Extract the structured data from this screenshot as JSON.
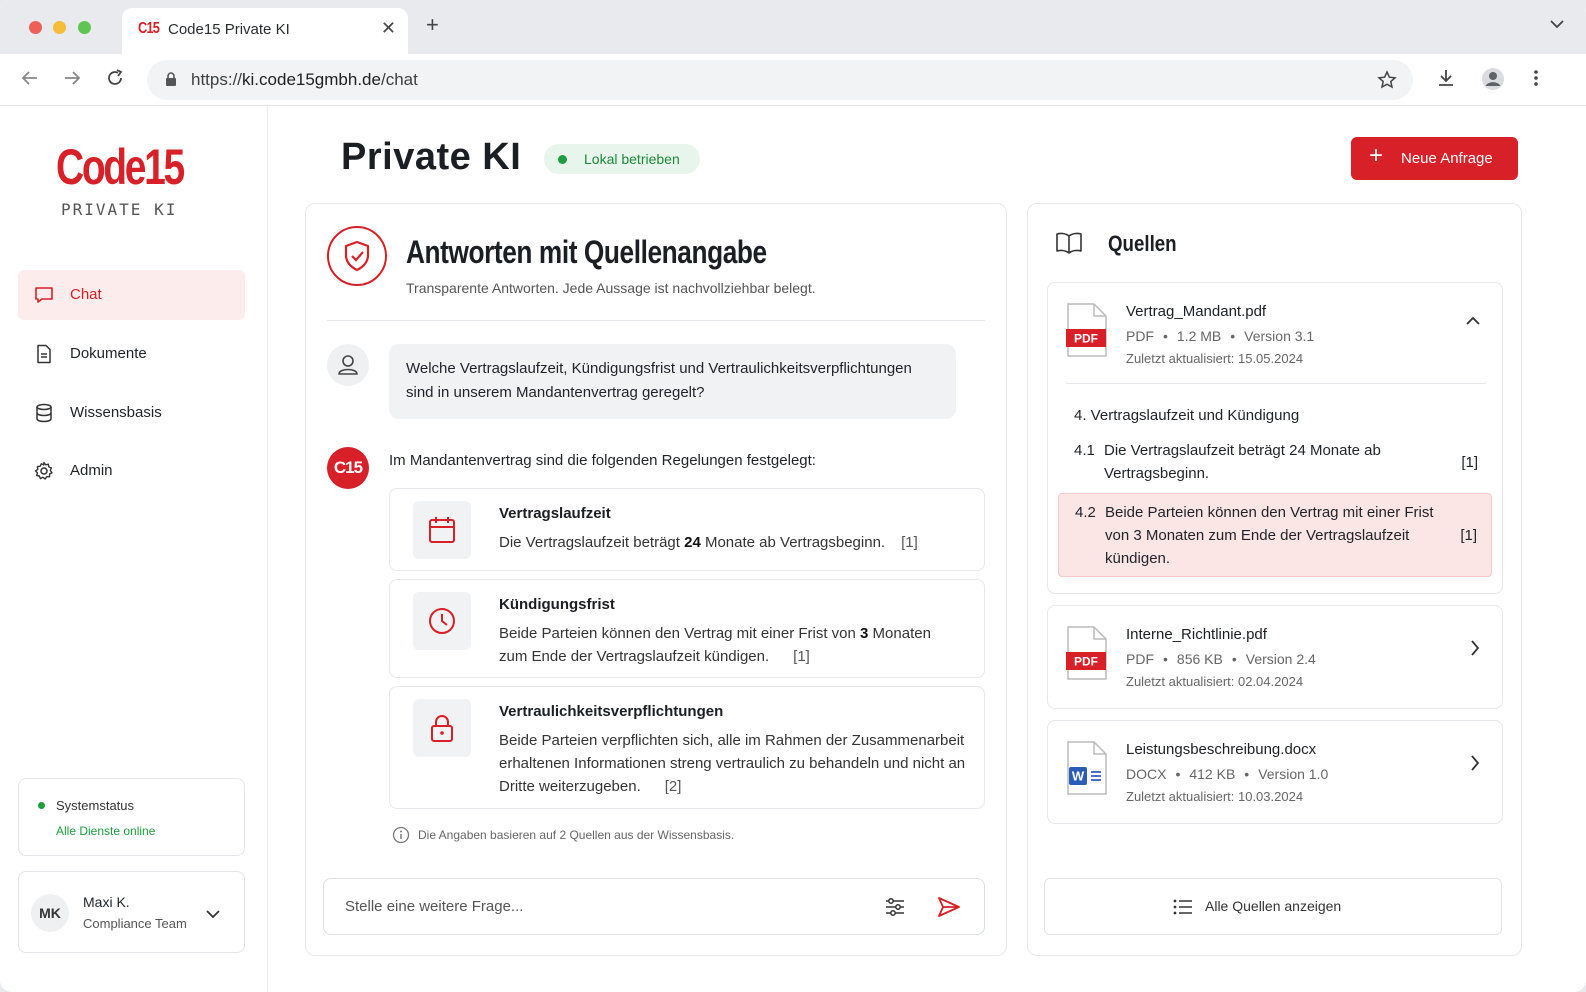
{
  "browser": {
    "tab_favicon": "C15",
    "tab_title": "Code15 Private KI",
    "url_scheme": "https://",
    "url_host": "ki.code15gmbh.de",
    "url_path": "/chat"
  },
  "sidebar": {
    "logo_main": "Code15",
    "logo_sub": "PRIVATE KI",
    "items": [
      {
        "label": "Chat",
        "icon": "chat-icon",
        "active": true
      },
      {
        "label": "Dokumente",
        "icon": "document-icon",
        "active": false
      },
      {
        "label": "Wissensbasis",
        "icon": "database-icon",
        "active": false
      },
      {
        "label": "Admin",
        "icon": "gear-icon",
        "active": false
      }
    ],
    "status": {
      "title": "Systemstatus",
      "sub": "Alle Dienste online"
    },
    "user": {
      "initials": "MK",
      "name": "Maxi K.",
      "team": "Compliance Team"
    }
  },
  "header": {
    "title": "Private KI",
    "badge": "Lokal betrieben",
    "new_button": "Neue Anfrage"
  },
  "main": {
    "title": "Antworten mit Quellenangabe",
    "subtitle": "Transparente Antworten. Jede Aussage ist nachvollziehbar belegt.",
    "question": "Welche Vertragslaufzeit, Kündigungsfrist und Vertraulichkeitsverpflichtungen sind in unserem Mandantenvertrag geregelt?",
    "answer_badge": "C15",
    "answer_intro": "Im Mandantenvertrag sind die folgenden Regelungen festgelegt:",
    "items": [
      {
        "title": "Vertragslaufzeit",
        "pre": "Die Vertragslaufzeit beträgt ",
        "bold": "24",
        "post": " Monate ab Vertragsbeginn.",
        "cite": "[1]",
        "icon": "calendar-icon"
      },
      {
        "title": "Kündigungsfrist",
        "pre": "Beide Parteien können den Vertrag mit einer Frist von ",
        "bold": "3",
        "post": " Monaten zum Ende der Vertragslaufzeit kündigen.",
        "cite": "[1]",
        "icon": "clock-icon"
      },
      {
        "title": "Vertraulichkeitsverpflichtungen",
        "pre": "Beide Parteien verpflichten sich, alle im Rahmen der Zusammenarbeit erhaltenen Informationen streng vertraulich zu behandeln und nicht an Dritte weiterzugeben.",
        "bold": "",
        "post": "",
        "cite": "[2]",
        "icon": "lock-icon"
      }
    ],
    "footnote": "Die Angaben basieren auf 2 Quellen aus der Wissensbasis.",
    "input_placeholder": "Stelle eine weitere Frage..."
  },
  "sources": {
    "title": "Quellen",
    "docs": [
      {
        "name": "Vertrag_Mandant.pdf",
        "type": "PDF",
        "size": "1.2 MB",
        "version": "Version 3.1",
        "updated": "Zuletzt aktualisiert: 15.05.2024",
        "expanded": true
      },
      {
        "name": "Interne_Richtlinie.pdf",
        "type": "PDF",
        "size": "856 KB",
        "version": "Version 2.4",
        "updated": "Zuletzt aktualisiert: 02.04.2024",
        "expanded": false
      },
      {
        "name": "Leistungsbeschreibung.docx",
        "type": "DOCX",
        "size": "412 KB",
        "version": "Version 1.0",
        "updated": "Zuletzt aktualisiert: 10.03.2024",
        "expanded": false
      }
    ],
    "section_title": "4. Vertragslaufzeit und Kündigung",
    "sections": [
      {
        "num": "4.1",
        "text": "Die Vertragslaufzeit beträgt 24 Monate ab Vertragsbeginn.",
        "cite": "[1]"
      },
      {
        "num": "4.2",
        "text": "Beide Parteien können den Vertrag mit einer Frist von 3 Monaten zum Ende der Vertragslaufzeit kündigen.",
        "cite": "[1]"
      }
    ],
    "all_button": "Alle Quellen anzeigen"
  },
  "colors": {
    "accent": "#d72027",
    "success": "#1e9e3e"
  }
}
